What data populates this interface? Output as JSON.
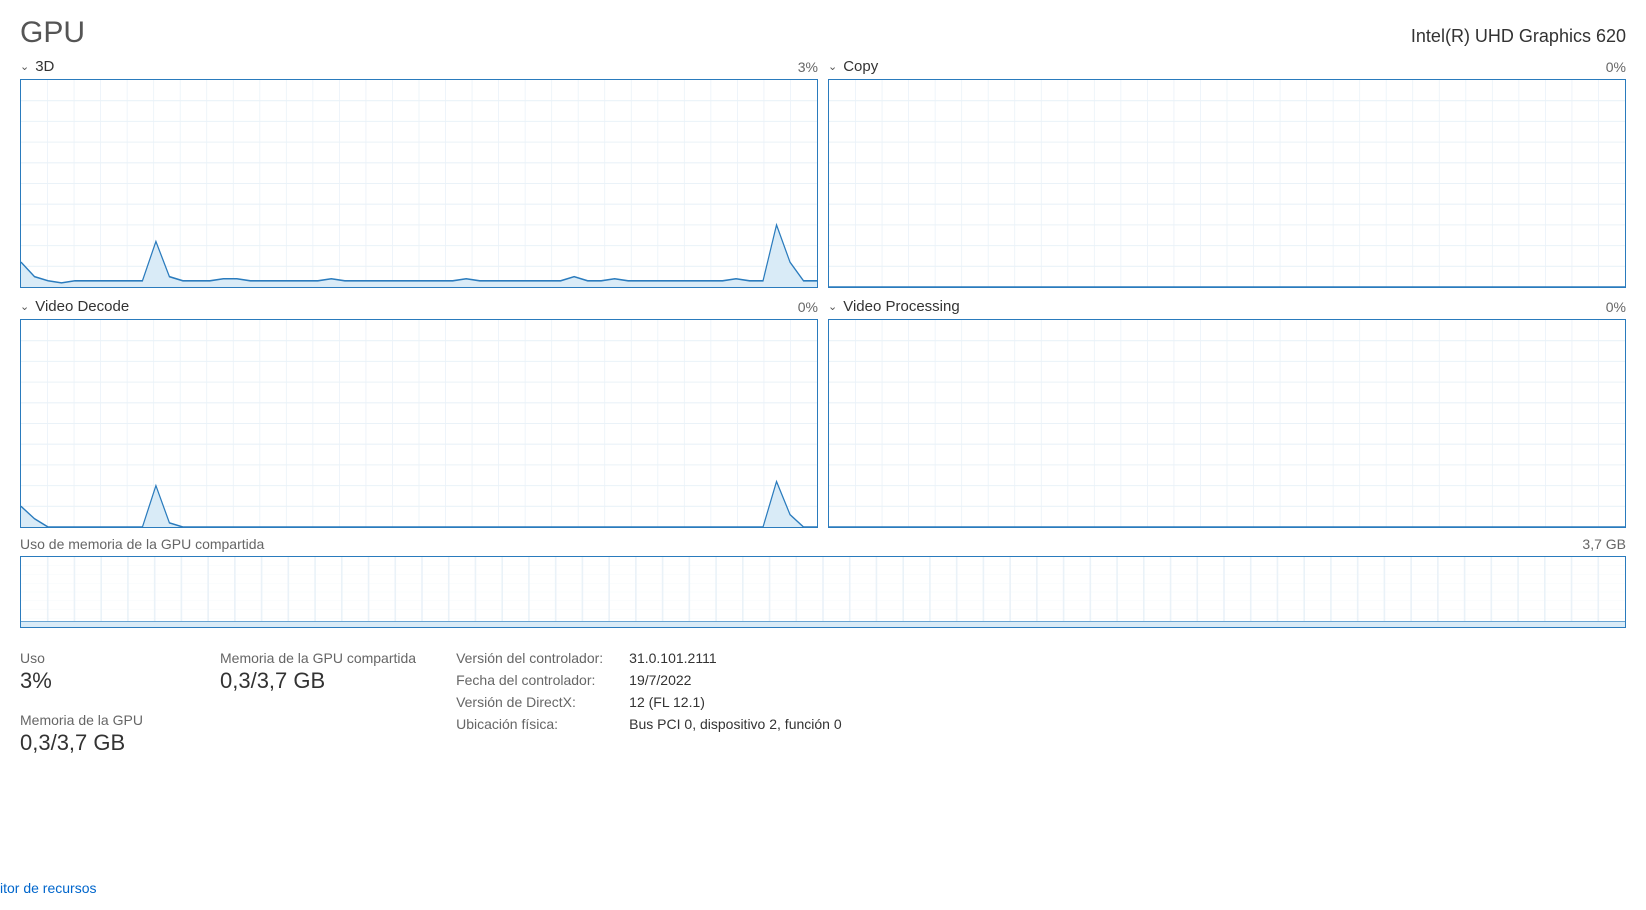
{
  "title": "GPU",
  "gpu_name": "Intel(R) UHD Graphics 620",
  "charts": {
    "c3d": {
      "label": "3D",
      "val": "3%"
    },
    "copy": {
      "label": "Copy",
      "val": "0%"
    },
    "vdecode": {
      "label": "Video Decode",
      "val": "0%"
    },
    "vproc": {
      "label": "Video Processing",
      "val": "0%"
    },
    "memshared": {
      "label": "Uso de memoria de la GPU compartida",
      "val": "3,7 GB"
    }
  },
  "stats": {
    "uso_lbl": "Uso",
    "uso_val": "3%",
    "gpumem_lbl": "Memoria de la GPU",
    "gpumem_val": "0,3/3,7 GB",
    "sharedmem_lbl": "Memoria de la GPU compartida",
    "sharedmem_val": "0,3/3,7 GB"
  },
  "details": {
    "driver_ver_lbl": "Versión del controlador:",
    "driver_ver": "31.0.101.2111",
    "driver_date_lbl": "Fecha del controlador:",
    "driver_date": "19/7/2022",
    "directx_lbl": "Versión de DirectX:",
    "directx": "12 (FL 12.1)",
    "phys_lbl": "Ubicación física:",
    "phys": "Bus PCI 0, dispositivo 2, función 0"
  },
  "link": "itor de recursos",
  "chart_data": [
    {
      "type": "line",
      "name": "3D",
      "ylim": [
        0,
        100
      ],
      "x": [
        0,
        1,
        2,
        3,
        4,
        5,
        6,
        7,
        8,
        9,
        10,
        11,
        12,
        13,
        14,
        15,
        16,
        17,
        18,
        19,
        20,
        21,
        22,
        23,
        24,
        25,
        26,
        27,
        28,
        29,
        30,
        31,
        32,
        33,
        34,
        35,
        36,
        37,
        38,
        39,
        40,
        41,
        42,
        43,
        44,
        45,
        46,
        47,
        48,
        49,
        50,
        51,
        52,
        53,
        54,
        55,
        56,
        57,
        58,
        59
      ],
      "values": [
        12,
        5,
        3,
        2,
        3,
        3,
        3,
        3,
        3,
        3,
        22,
        5,
        3,
        3,
        3,
        4,
        4,
        3,
        3,
        3,
        3,
        3,
        3,
        4,
        3,
        3,
        3,
        3,
        3,
        3,
        3,
        3,
        3,
        4,
        3,
        3,
        3,
        3,
        3,
        3,
        3,
        5,
        3,
        3,
        4,
        3,
        3,
        3,
        3,
        3,
        3,
        3,
        3,
        4,
        3,
        3,
        30,
        12,
        3,
        3
      ]
    },
    {
      "type": "line",
      "name": "Copy",
      "ylim": [
        0,
        100
      ],
      "x": [
        0,
        1,
        2,
        3,
        4,
        5,
        6,
        7,
        8,
        9,
        10,
        11,
        12,
        13,
        14,
        15,
        16,
        17,
        18,
        19,
        20,
        21,
        22,
        23,
        24,
        25,
        26,
        27,
        28,
        29,
        30,
        31,
        32,
        33,
        34,
        35,
        36,
        37,
        38,
        39,
        40,
        41,
        42,
        43,
        44,
        45,
        46,
        47,
        48,
        49,
        50,
        51,
        52,
        53,
        54,
        55,
        56,
        57,
        58,
        59
      ],
      "values": [
        0,
        0,
        0,
        0,
        0,
        0,
        0,
        0,
        0,
        0,
        0,
        0,
        0,
        0,
        0,
        0,
        0,
        0,
        0,
        0,
        0,
        0,
        0,
        0,
        0,
        0,
        0,
        0,
        0,
        0,
        0,
        0,
        0,
        0,
        0,
        0,
        0,
        0,
        0,
        0,
        0,
        0,
        0,
        0,
        0,
        0,
        0,
        0,
        0,
        0,
        0,
        0,
        0,
        0,
        0,
        0,
        0,
        0,
        0,
        0
      ]
    },
    {
      "type": "line",
      "name": "Video Decode",
      "ylim": [
        0,
        100
      ],
      "x": [
        0,
        1,
        2,
        3,
        4,
        5,
        6,
        7,
        8,
        9,
        10,
        11,
        12,
        13,
        14,
        15,
        16,
        17,
        18,
        19,
        20,
        21,
        22,
        23,
        24,
        25,
        26,
        27,
        28,
        29,
        30,
        31,
        32,
        33,
        34,
        35,
        36,
        37,
        38,
        39,
        40,
        41,
        42,
        43,
        44,
        45,
        46,
        47,
        48,
        49,
        50,
        51,
        52,
        53,
        54,
        55,
        56,
        57,
        58,
        59
      ],
      "values": [
        10,
        4,
        0,
        0,
        0,
        0,
        0,
        0,
        0,
        0,
        20,
        2,
        0,
        0,
        0,
        0,
        0,
        0,
        0,
        0,
        0,
        0,
        0,
        0,
        0,
        0,
        0,
        0,
        0,
        0,
        0,
        0,
        0,
        0,
        0,
        0,
        0,
        0,
        0,
        0,
        0,
        0,
        0,
        0,
        0,
        0,
        0,
        0,
        0,
        0,
        0,
        0,
        0,
        0,
        0,
        0,
        22,
        6,
        0,
        0
      ]
    },
    {
      "type": "line",
      "name": "Video Processing",
      "ylim": [
        0,
        100
      ],
      "x": [
        0,
        1,
        2,
        3,
        4,
        5,
        6,
        7,
        8,
        9,
        10,
        11,
        12,
        13,
        14,
        15,
        16,
        17,
        18,
        19,
        20,
        21,
        22,
        23,
        24,
        25,
        26,
        27,
        28,
        29,
        30,
        31,
        32,
        33,
        34,
        35,
        36,
        37,
        38,
        39,
        40,
        41,
        42,
        43,
        44,
        45,
        46,
        47,
        48,
        49,
        50,
        51,
        52,
        53,
        54,
        55,
        56,
        57,
        58,
        59
      ],
      "values": [
        0,
        0,
        0,
        0,
        0,
        0,
        0,
        0,
        0,
        0,
        0,
        0,
        0,
        0,
        0,
        0,
        0,
        0,
        0,
        0,
        0,
        0,
        0,
        0,
        0,
        0,
        0,
        0,
        0,
        0,
        0,
        0,
        0,
        0,
        0,
        0,
        0,
        0,
        0,
        0,
        0,
        0,
        0,
        0,
        0,
        0,
        0,
        0,
        0,
        0,
        0,
        0,
        0,
        0,
        0,
        0,
        0,
        0,
        0,
        0
      ]
    },
    {
      "type": "line",
      "name": "Uso de memoria de la GPU compartida",
      "ylim": [
        0,
        3.7
      ],
      "x": [
        0,
        1,
        2,
        3,
        4,
        5,
        6,
        7,
        8,
        9,
        10,
        11,
        12,
        13,
        14,
        15,
        16,
        17,
        18,
        19,
        20,
        21,
        22,
        23,
        24,
        25,
        26,
        27,
        28,
        29,
        30,
        31,
        32,
        33,
        34,
        35,
        36,
        37,
        38,
        39,
        40,
        41,
        42,
        43,
        44,
        45,
        46,
        47,
        48,
        49,
        50,
        51,
        52,
        53,
        54,
        55,
        56,
        57,
        58,
        59
      ],
      "values": [
        0.3,
        0.3,
        0.3,
        0.3,
        0.3,
        0.3,
        0.3,
        0.3,
        0.3,
        0.3,
        0.3,
        0.3,
        0.3,
        0.3,
        0.3,
        0.3,
        0.3,
        0.3,
        0.3,
        0.3,
        0.3,
        0.3,
        0.3,
        0.3,
        0.3,
        0.3,
        0.3,
        0.3,
        0.3,
        0.3,
        0.3,
        0.3,
        0.3,
        0.3,
        0.3,
        0.3,
        0.3,
        0.3,
        0.3,
        0.3,
        0.3,
        0.3,
        0.3,
        0.3,
        0.3,
        0.3,
        0.3,
        0.3,
        0.3,
        0.3,
        0.3,
        0.3,
        0.3,
        0.3,
        0.3,
        0.3,
        0.3,
        0.3,
        0.3,
        0.3
      ]
    }
  ],
  "colors": {
    "stroke": "#2a7bbd",
    "fill": "#d9ebf7",
    "grid": "#eaf2f8"
  }
}
